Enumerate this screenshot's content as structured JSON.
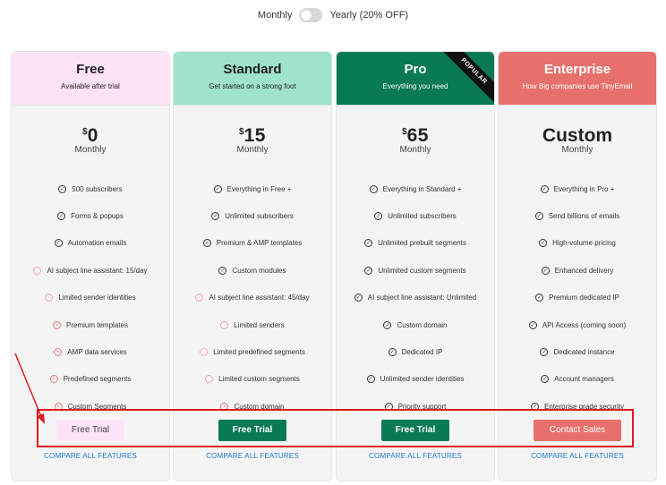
{
  "billing_toggle": {
    "monthly_label": "Monthly",
    "yearly_label": "Yearly (20% OFF)"
  },
  "colors": {
    "free": "#fde3f8",
    "standard": "#9fe3cf",
    "pro": "#0a7a55",
    "enterprise": "#e8706c",
    "link": "#1d76d2",
    "highlight": "#e01b1b"
  },
  "plans": [
    {
      "name": "Free",
      "subtitle": "Available after trial",
      "currency": "$",
      "price": "0",
      "period": "Monthly",
      "features": [
        {
          "icon": "check-icon",
          "text": "500 subscribers"
        },
        {
          "icon": "check-icon",
          "text": "Forms & popups"
        },
        {
          "icon": "check-icon",
          "text": "Automation emails"
        },
        {
          "icon": "partial-icon",
          "text": "AI subject line assistant: 15/day"
        },
        {
          "icon": "partial-icon",
          "text": "Limited sender identities"
        },
        {
          "icon": "cross-icon",
          "text": "Premium templates"
        },
        {
          "icon": "cross-icon",
          "text": "AMP data services"
        },
        {
          "icon": "cross-icon",
          "text": "Predefined segments"
        },
        {
          "icon": "cross-icon",
          "text": "Custom Segments"
        }
      ],
      "cta": "Free Trial",
      "compare": "COMPARE ALL FEATURES"
    },
    {
      "name": "Standard",
      "subtitle": "Get started on a strong foot",
      "currency": "$",
      "price": "15",
      "period": "Monthly",
      "features": [
        {
          "icon": "check-icon",
          "text": "Everything in Free +"
        },
        {
          "icon": "check-icon",
          "text": "Unlimited subscribers"
        },
        {
          "icon": "check-icon",
          "text": "Premium & AMP templates"
        },
        {
          "icon": "check-icon",
          "text": "Custom modules"
        },
        {
          "icon": "partial-icon",
          "text": "AI subject line assistant: 45/day"
        },
        {
          "icon": "partial-icon",
          "text": "Limited senders"
        },
        {
          "icon": "partial-icon",
          "text": "Limited predefined segments"
        },
        {
          "icon": "partial-icon",
          "text": "Limited custom segments"
        },
        {
          "icon": "cross-icon",
          "text": "Custom domain"
        }
      ],
      "cta": "Free Trial",
      "compare": "COMPARE ALL FEATURES"
    },
    {
      "name": "Pro",
      "subtitle": "Everything you need",
      "badge": "POPULAR",
      "currency": "$",
      "price": "65",
      "period": "Monthly",
      "features": [
        {
          "icon": "check-icon",
          "text": "Everything in Standard +"
        },
        {
          "icon": "check-icon",
          "text": "Unlimited subscribers"
        },
        {
          "icon": "check-icon",
          "text": "Unlimited prebuilt segments"
        },
        {
          "icon": "check-icon",
          "text": "Unlimited custom segments"
        },
        {
          "icon": "check-icon",
          "text": "AI subject line assistant: Unlimited"
        },
        {
          "icon": "check-icon",
          "text": "Custom domain"
        },
        {
          "icon": "check-icon",
          "text": "Dedicated IP"
        },
        {
          "icon": "check-icon",
          "text": "Unlimited sender identities"
        },
        {
          "icon": "check-icon",
          "text": "Priority support"
        }
      ],
      "cta": "Free Trial",
      "compare": "COMPARE ALL FEATURES"
    },
    {
      "name": "Enterprise",
      "subtitle": "How Big companies use TinyEmail",
      "price": "Custom",
      "period": "Monthly",
      "features": [
        {
          "icon": "check-icon",
          "text": "Everything in Pro +"
        },
        {
          "icon": "check-icon",
          "text": "Send billions of emails"
        },
        {
          "icon": "check-icon",
          "text": "High-volume pricing"
        },
        {
          "icon": "check-icon",
          "text": "Enhanced delivery"
        },
        {
          "icon": "check-icon",
          "text": "Premium dedicated IP"
        },
        {
          "icon": "check-icon",
          "text": "API Access (coming soon)"
        },
        {
          "icon": "check-icon",
          "text": "Dedicated instance"
        },
        {
          "icon": "check-icon",
          "text": "Account managers"
        },
        {
          "icon": "check-icon",
          "text": "Enterprise grade security"
        }
      ],
      "cta": "Contact Sales",
      "compare": "COMPARE ALL FEATURES"
    }
  ]
}
